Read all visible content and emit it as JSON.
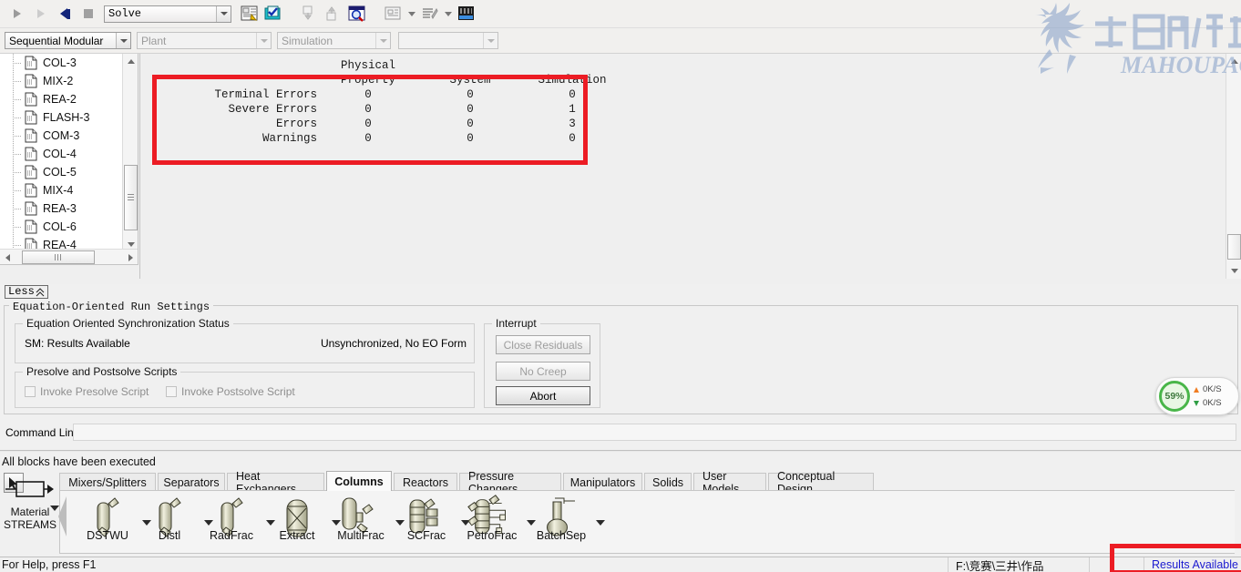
{
  "toolbar": {
    "run_icon": "play-icon",
    "step_icon": "step-icon",
    "reset_icon": "reset-icon",
    "stop_icon": "stop-icon",
    "solve_mode": "Solve",
    "icons": [
      "control-panel-icon",
      "check-results-icon",
      "input-changes-icon",
      "reconcile-streams-icon",
      "report-zoom-icon",
      "model-summary-icon",
      "stream-summary-icon",
      "data-browser-icon"
    ]
  },
  "toolbar2": {
    "run_mode": "Sequential Modular",
    "flowsheet_section": "Plant",
    "run_type": "Simulation",
    "extra": ""
  },
  "tree": {
    "items": [
      {
        "label": "COL-3"
      },
      {
        "label": "MIX-2"
      },
      {
        "label": "REA-2"
      },
      {
        "label": "FLASH-3"
      },
      {
        "label": "COM-3"
      },
      {
        "label": "COL-4"
      },
      {
        "label": "COL-5"
      },
      {
        "label": "MIX-4"
      },
      {
        "label": "REA-3"
      },
      {
        "label": "COL-6"
      },
      {
        "label": "REA-4"
      }
    ]
  },
  "report": {
    "group_header": "Physical",
    "columns": [
      "Property",
      "System",
      "Simulation"
    ],
    "rows": [
      {
        "label": "Terminal Errors",
        "values": [
          "0",
          "0",
          "0"
        ]
      },
      {
        "label": "Severe Errors",
        "values": [
          "0",
          "0",
          "1"
        ]
      },
      {
        "label": "Errors",
        "values": [
          "0",
          "0",
          "3"
        ]
      },
      {
        "label": "Warnings",
        "values": [
          "0",
          "0",
          "0"
        ]
      }
    ]
  },
  "less_button": {
    "label": "Less",
    "icon": "chevron-double-up-icon"
  },
  "eo_settings": {
    "group_title": "Equation-Oriented Run Settings",
    "sync_group": {
      "title": "Equation Oriented Synchronization Status",
      "left": "SM: Results Available",
      "right": "Unsynchronized, No EO Form"
    },
    "scripts_group": {
      "title": "Presolve and Postsolve Scripts",
      "presolve_label": "Invoke Presolve Script",
      "postsolve_label": "Invoke Postsolve Script"
    },
    "interrupt_group": {
      "title": "Interrupt",
      "buttons": [
        {
          "label": "Close Residuals",
          "enabled": false
        },
        {
          "label": "No Creep",
          "enabled": false
        },
        {
          "label": "Abort",
          "enabled": true
        }
      ]
    }
  },
  "command_line": {
    "label": "Command Line:",
    "value": "",
    "placeholder": ""
  },
  "execution_message": "All blocks have been executed",
  "palette": {
    "cursor_tool": "arrow-cursor-icon",
    "stream_tool": {
      "line1": "Material",
      "line2": "STREAMS"
    },
    "tabs": [
      {
        "label": "Mixers/Splitters",
        "active": false
      },
      {
        "label": "Separators",
        "active": false
      },
      {
        "label": "Heat Exchangers",
        "active": false
      },
      {
        "label": "Columns",
        "active": true
      },
      {
        "label": "Reactors",
        "active": false
      },
      {
        "label": "Pressure Changers",
        "active": false
      },
      {
        "label": "Manipulators",
        "active": false
      },
      {
        "label": "Solids",
        "active": false
      },
      {
        "label": "User Models",
        "active": false
      },
      {
        "label": "Conceptual Design",
        "active": false
      }
    ],
    "models": [
      {
        "label": "DSTWU",
        "icon": "column-icon"
      },
      {
        "label": "Distl",
        "icon": "column-icon"
      },
      {
        "label": "RadFrac",
        "icon": "column-icon"
      },
      {
        "label": "Extract",
        "icon": "extractor-icon"
      },
      {
        "label": "MultiFrac",
        "icon": "multifrac-icon"
      },
      {
        "label": "SCFrac",
        "icon": "scfrac-icon"
      },
      {
        "label": "PetroFrac",
        "icon": "petrofrac-icon"
      },
      {
        "label": "BatchSep",
        "icon": "batchsep-icon"
      }
    ]
  },
  "status_bar": {
    "help": "For Help, press F1",
    "path": "F:\\竞赛\\三井\\作品",
    "middle": "",
    "results": "Results Available"
  },
  "network_widget": {
    "cpu_percent": "59%",
    "upload": "0K/S",
    "download": "0K/S"
  },
  "watermark": {
    "chinese": "马后炮化工",
    "latin": "MAHOUPAO"
  },
  "colors": {
    "highlight_red": "#ec1c24",
    "results_blue": "#1a1ad0",
    "accent_green": "#49b649",
    "watermark_blue": "#8fa7cc"
  }
}
